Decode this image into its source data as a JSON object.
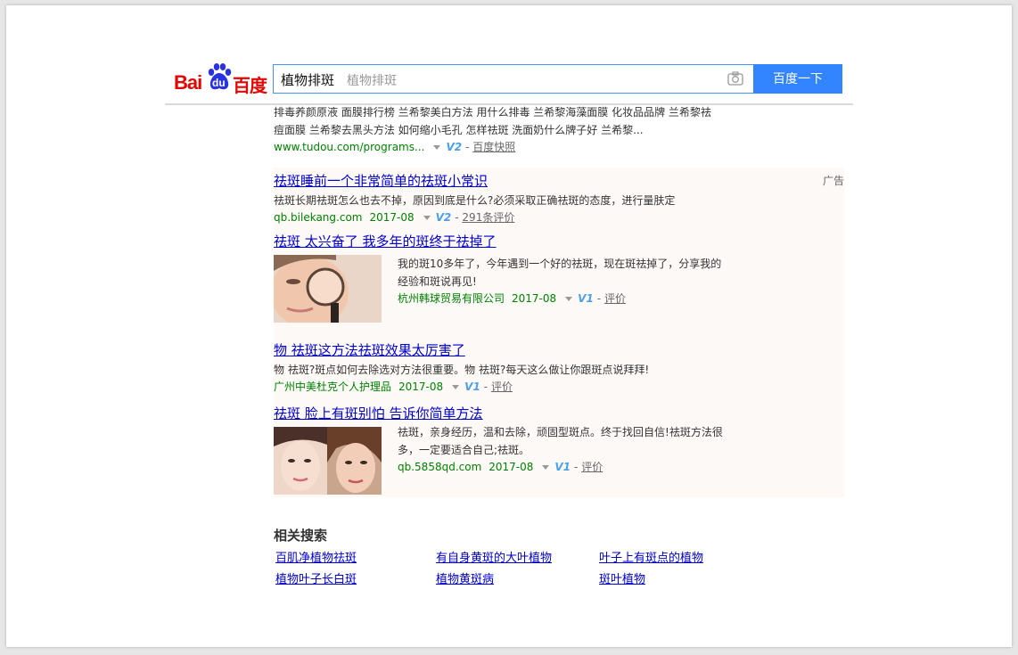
{
  "search": {
    "query": "植物排斑",
    "suggestion": "植物排斑",
    "button_label": "百度一下"
  },
  "logo": {
    "bai": "Bai",
    "du": "du",
    "cn": "百度"
  },
  "top_result": {
    "snippet_line1": "排毒养颜原液 面膜排行榜 兰希黎美白方法 用什么排毒 兰希黎海藻面膜 化妆品品牌 兰希黎祛",
    "snippet_line2": "痘面膜 兰希黎去黑头方法 如何缩小毛孔 怎样祛斑 洗面奶什么牌子好 兰希黎...",
    "url": "www.tudou.com/programs...",
    "v_badge": "V2",
    "cache_label": "百度快照"
  },
  "ads": {
    "label": "广告",
    "items": [
      {
        "title": "祛斑睡前一个非常简单的祛斑小常识",
        "snippet": "祛斑长期祛斑怎么也去不掉，原因到底是什么?必须采取正确祛斑的态度，进行量肤定",
        "source": "qb.bilekang.com",
        "date": "2017-08",
        "v_badge": "V2",
        "reviews": "291条评价"
      },
      {
        "title": "祛斑 太兴奋了 我多年的斑终于祛掉了",
        "snippet_line1": "我的斑10多年了，今年遇到一个好的祛斑，现在斑祛掉了，分享我的",
        "snippet_line2": "经验和斑说再见!",
        "source": "杭州韩球贸易有限公司",
        "date": "2017-08",
        "v_badge": "V1",
        "reviews": "评价"
      },
      {
        "title": "物 祛斑这方法祛斑效果太厉害了",
        "snippet": "物 祛斑?斑点如何去除选对方法很重要。物 祛斑?每天这么做让你跟斑点说拜拜!",
        "source": "广州中美杜克个人护理品",
        "date": "2017-08",
        "v_badge": "V1",
        "reviews": "评价"
      },
      {
        "title": "祛斑 脸上有斑别怕 告诉你简单方法",
        "snippet_line1": "祛斑，亲身经历，温和去除，顽固型斑点。终于找回自信!祛斑方法很",
        "snippet_line2": "多，一定要适合自己;祛斑。",
        "source": "qb.5858qd.com",
        "date": "2017-08",
        "v_badge": "V1",
        "reviews": "评价"
      }
    ]
  },
  "related": {
    "title": "相关搜索",
    "links": [
      "百肌净植物祛斑",
      "有自身黄斑的大叶植物",
      "叶子上有斑点的植物",
      "植物叶子长白斑",
      "植物黄斑病",
      "斑叶植物"
    ]
  },
  "colors": {
    "accent": "#3385ff",
    "link": "#0000cc",
    "url_green": "#008000",
    "logo_red": "#e10602",
    "logo_blue": "#2932e1"
  }
}
